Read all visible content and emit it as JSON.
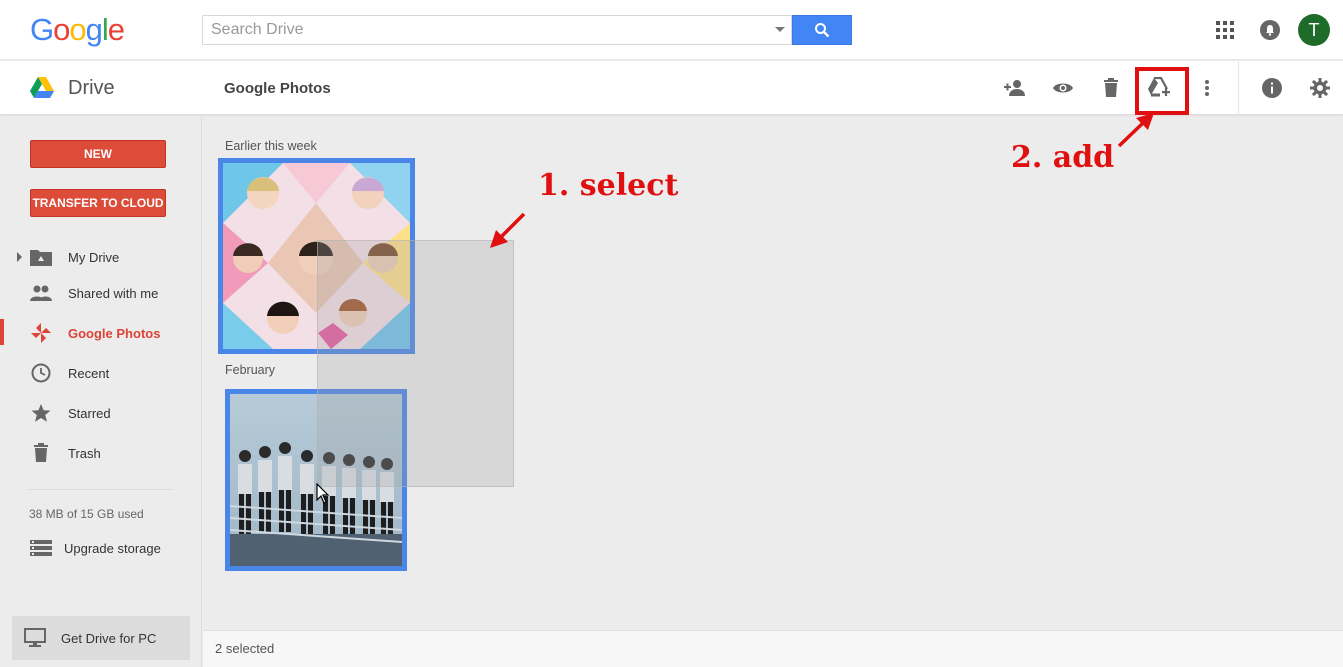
{
  "header": {
    "logo_text": "Google",
    "search_placeholder": "Search Drive",
    "avatar_letter": "T"
  },
  "toolbar": {
    "app_name": "Drive",
    "folder_title": "Google Photos",
    "icons": [
      "add-person-icon",
      "preview-eye-icon",
      "trash-icon",
      "add-to-drive-icon",
      "more-vert-icon",
      "info-icon",
      "settings-gear-icon"
    ]
  },
  "sidebar": {
    "new_button": "NEW",
    "transfer_button": "TRANSFER TO CLOUD",
    "items": [
      {
        "label": "My Drive",
        "icon": "folder-drive-icon"
      },
      {
        "label": "Shared with me",
        "icon": "people-icon"
      },
      {
        "label": "Google Photos",
        "icon": "pinwheel-icon",
        "active": true
      },
      {
        "label": "Recent",
        "icon": "clock-icon"
      },
      {
        "label": "Starred",
        "icon": "star-icon"
      },
      {
        "label": "Trash",
        "icon": "trash-icon"
      }
    ],
    "storage_text": "38 MB of 15 GB used",
    "upgrade_label": "Upgrade storage",
    "get_drive_label": "Get Drive for PC"
  },
  "main": {
    "sections": [
      {
        "label": "Earlier this week"
      },
      {
        "label": "February"
      }
    ]
  },
  "annotations": {
    "select": "1. select",
    "add": "2. add"
  },
  "status": {
    "selected_text": "2 selected"
  },
  "colors": {
    "accent_red": "#dd4b39",
    "selection_blue": "#4a86e8",
    "search_blue": "#4285f4",
    "annotation_red": "#e01010"
  }
}
